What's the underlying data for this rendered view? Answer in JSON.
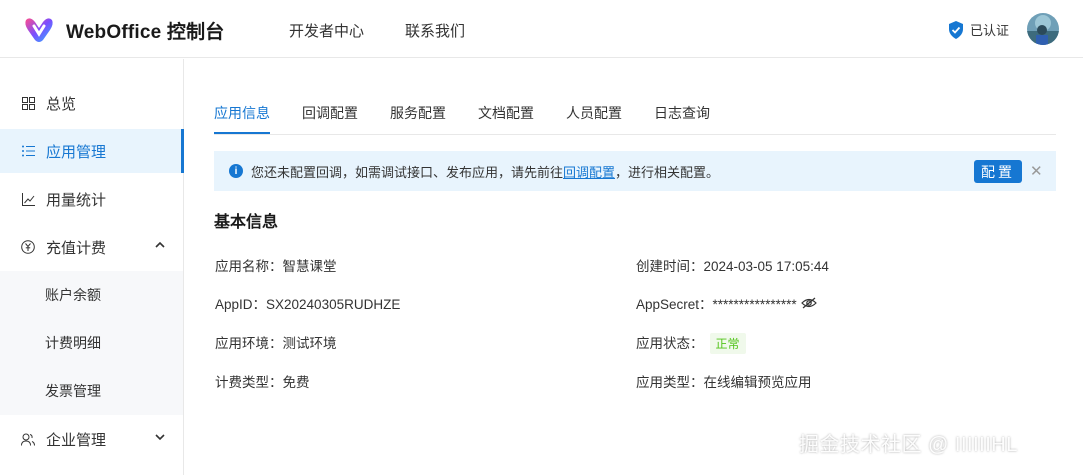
{
  "header": {
    "brand": "WebOffice 控制台",
    "nav": [
      "开发者中心",
      "联系我们"
    ],
    "verified": "已认证"
  },
  "sidebar": {
    "items": [
      {
        "label": "总览"
      },
      {
        "label": "应用管理"
      },
      {
        "label": "用量统计"
      },
      {
        "label": "充值计费"
      },
      {
        "label": "账户余额"
      },
      {
        "label": "计费明细"
      },
      {
        "label": "发票管理"
      },
      {
        "label": "企业管理"
      }
    ]
  },
  "tabs": [
    "应用信息",
    "回调配置",
    "服务配置",
    "文档配置",
    "人员配置",
    "日志查询"
  ],
  "alert": {
    "text_before": "您还未配置回调，如需调试接口、发布应用，请先前往",
    "link": "回调配置",
    "text_after": "，进行相关配置。",
    "button": "配置"
  },
  "basic_info": {
    "title": "基本信息",
    "app_name": "应用名称：智慧课堂",
    "created": "创建时间：2024-03-05 17:05:44",
    "app_id": "AppID：SX20240305RUDHZE",
    "app_secret": "AppSecret：****************",
    "env": "应用环境：测试环境",
    "status_label": "应用状态：",
    "status_value": "正常",
    "billing": "计费类型：免费",
    "app_type": "应用类型：在线编辑预览应用"
  },
  "watermark": "掘金技术社区 @ IIIIIIHL"
}
